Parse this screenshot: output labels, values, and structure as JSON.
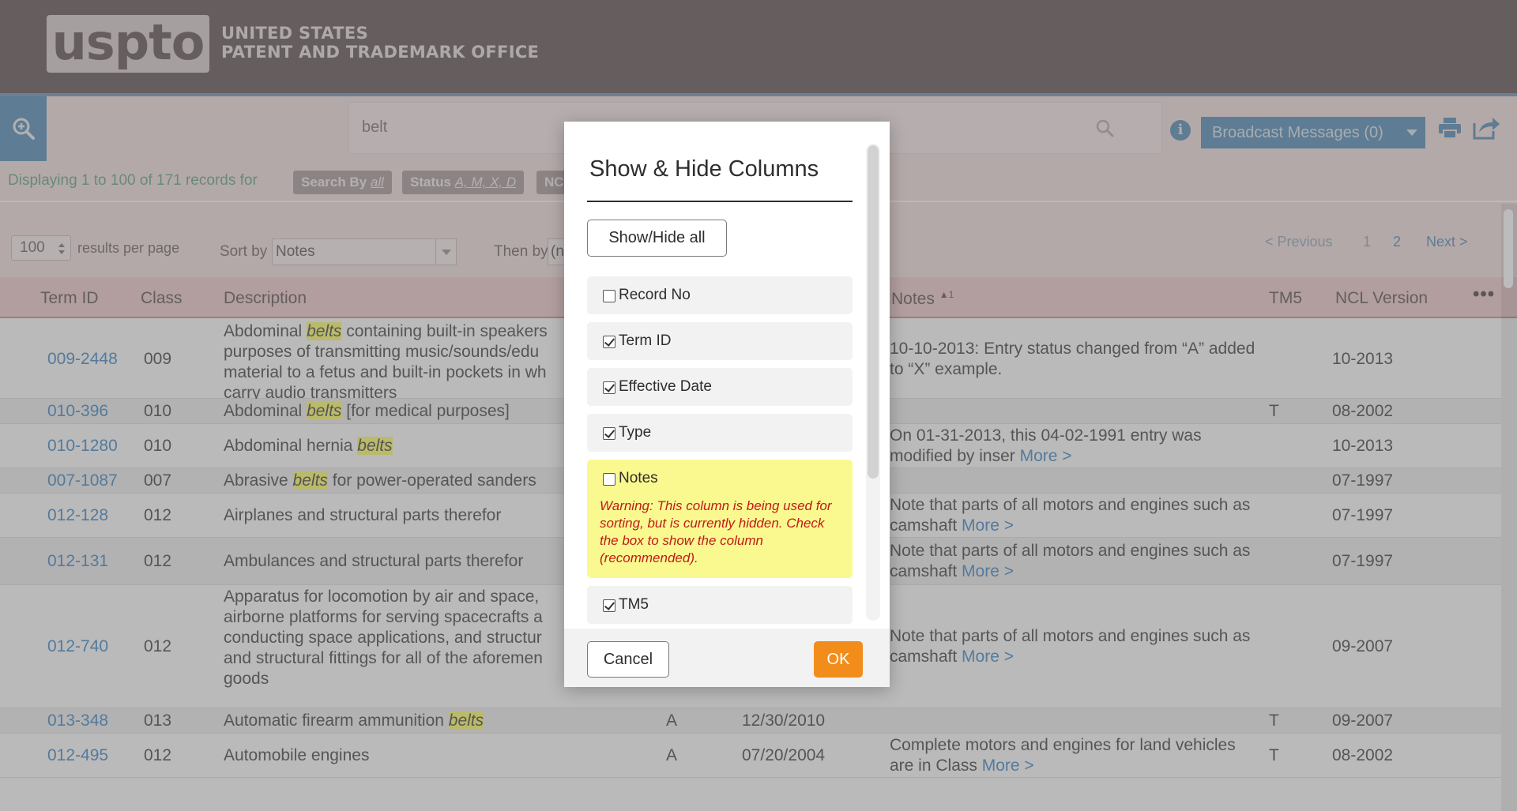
{
  "header": {
    "logo_text": "uspto",
    "office_line1": "UNITED STATES",
    "office_line2": "PATENT AND TRADEMARK OFFICE"
  },
  "toolbar": {
    "search_value": "belt",
    "broadcast_label": "Broadcast Messages (0)"
  },
  "filter": {
    "displaying": "Displaying 1 to 100 of 171 records for",
    "chips": [
      {
        "key": "Search By",
        "value": "all"
      },
      {
        "key": "Status",
        "value": "A, M, X, D"
      },
      {
        "key": "NC",
        "value": ""
      }
    ]
  },
  "controls": {
    "per_page_value": "100",
    "per_page_label": "results per page",
    "sort_by_label": "Sort by",
    "sort_by_value": "Notes",
    "then_by_label": "Then by",
    "then_by_value": "(no",
    "pager": {
      "previous": "< Previous",
      "page1": "1",
      "page2": "2",
      "next": "Next >"
    }
  },
  "table": {
    "headers": {
      "term_id": "Term ID",
      "class": "Class",
      "description": "Description",
      "notes": "Notes",
      "sort_indicator": "▲1",
      "tm5": "TM5",
      "ncl": "NCL Version"
    },
    "rows": [
      {
        "id": "009-2448",
        "cls": "009",
        "d1": "Abdominal ",
        "dh": "belts",
        "d2": " containing built-in speakers",
        "extra": [
          "purposes of transmitting music/sounds/edu",
          "material to a fetus and built-in pockets in wh",
          "carry audio transmitters"
        ],
        "status": "",
        "date": "",
        "notes": "10-10-2013: Entry status changed from “A” added to “X” example.",
        "more": "",
        "tm5": "",
        "ncl": "10-2013"
      },
      {
        "id": "010-396",
        "cls": "010",
        "d1": "Abdominal ",
        "dh": "belts",
        "d2": " [for medical purposes]",
        "extra": [],
        "status": "",
        "date": "",
        "notes": "",
        "more": "",
        "tm5": "T",
        "ncl": "08-2002"
      },
      {
        "id": "010-1280",
        "cls": "010",
        "d1": "Abdominal hernia ",
        "dh": "belts",
        "d2": "",
        "extra": [],
        "status": "",
        "date": "",
        "notes": "On 01-31-2013, this 04-02-1991 entry was modified by inser",
        "more": "More >",
        "tm5": "",
        "ncl": "10-2013"
      },
      {
        "id": "007-1087",
        "cls": "007",
        "d1": "Abrasive ",
        "dh": "belts",
        "d2": " for power-operated sanders",
        "extra": [],
        "status": "",
        "date": "",
        "notes": "",
        "more": "",
        "tm5": "",
        "ncl": "07-1997"
      },
      {
        "id": "012-128",
        "cls": "012",
        "d1": "Airplanes and structural parts therefor",
        "dh": "",
        "d2": "",
        "extra": [],
        "status": "",
        "date": "",
        "notes": "Note that parts of all motors and engines such as camshaft",
        "more": "More >",
        "tm5": "",
        "ncl": "07-1997"
      },
      {
        "id": "012-131",
        "cls": "012",
        "d1": "Ambulances and structural parts therefor",
        "dh": "",
        "d2": "",
        "extra": [],
        "status": "",
        "date": "",
        "notes": "Note that parts of all motors and engines such as camshaft",
        "more": "More >",
        "tm5": "",
        "ncl": "07-1997"
      },
      {
        "id": "012-740",
        "cls": "012",
        "d1": "Apparatus for locomotion by air and space,",
        "dh": "",
        "d2": "",
        "extra": [
          "airborne platforms for serving spacecrafts a",
          "conducting space applications, and structur",
          "and structural fittings for all of the aforemen",
          "goods"
        ],
        "status": "",
        "date": "",
        "notes": "Note that parts of all motors and engines such as camshaft",
        "more": "More >",
        "tm5": "",
        "ncl": "09-2007"
      },
      {
        "id": "013-348",
        "cls": "013",
        "d1": "Automatic firearm ammunition ",
        "dh": "belts",
        "d2": "",
        "extra": [],
        "status": "A",
        "date": "12/30/2010",
        "notes": "",
        "more": "",
        "tm5": "T",
        "ncl": "09-2007"
      },
      {
        "id": "012-495",
        "cls": "012",
        "d1": "Automobile engines",
        "dh": "",
        "d2": "",
        "extra": [],
        "status": "A",
        "date": "07/20/2004",
        "notes": "Complete motors and engines for land vehicles are in Class",
        "more": "More >",
        "tm5": "T",
        "ncl": "08-2002"
      }
    ]
  },
  "modal": {
    "title": "Show & Hide Columns",
    "show_hide_all": "Show/Hide all",
    "options": [
      {
        "label": "Record No",
        "checked": false
      },
      {
        "label": "Term ID",
        "checked": true
      },
      {
        "label": "Effective Date",
        "checked": true
      },
      {
        "label": "Type",
        "checked": true
      },
      {
        "label": "Notes",
        "checked": false,
        "warning": "Warning: This column is being used for sorting, but is currently hidden. Check the box to show the column (recommended)."
      },
      {
        "label": "TM5",
        "checked": true
      }
    ],
    "cancel": "Cancel",
    "ok": "OK"
  },
  "colors": {
    "header_bg": "#5e5050",
    "link_blue": "#3c85c6",
    "ok_orange": "#f28c1a",
    "warning_yellow": "#faf98f",
    "warning_red": "#c01a1a"
  }
}
